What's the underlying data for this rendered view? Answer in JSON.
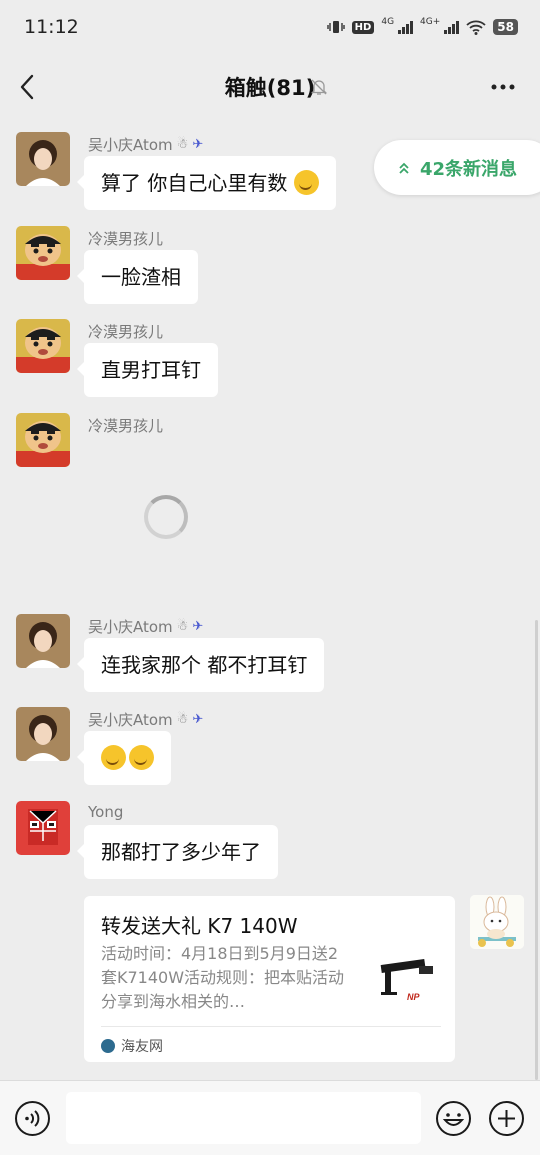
{
  "status_bar": {
    "time": "11:12",
    "hd": "HD",
    "net1": "4G",
    "net2": "4G+",
    "battery": "58"
  },
  "header": {
    "title": "箱触(81)"
  },
  "new_messages": {
    "label": "42条新消息"
  },
  "messages": [
    {
      "sender": "吴小庆Atom",
      "text": "算了 你自己心里有数",
      "emoji": true
    },
    {
      "sender": "冷漠男孩儿",
      "text": "一脸渣相"
    },
    {
      "sender": "冷漠男孩儿",
      "text": "直男打耳钉"
    },
    {
      "sender": "冷漠男孩儿",
      "text": ""
    },
    {
      "sender": "吴小庆Atom",
      "text": "连我家那个 都不打耳钉"
    },
    {
      "sender": "吴小庆Atom",
      "text": ""
    },
    {
      "sender": "Yong",
      "text": "那都打了多少年了"
    }
  ],
  "card": {
    "title": "转发送大礼 K7 140W",
    "description": "活动时间：4月18日到5月9日送2套K7140W活动规则：把本贴活动分享到海水相关的…",
    "source": "海友网"
  },
  "colors": {
    "accent_green": "#3aa66a",
    "background": "#ededed"
  }
}
